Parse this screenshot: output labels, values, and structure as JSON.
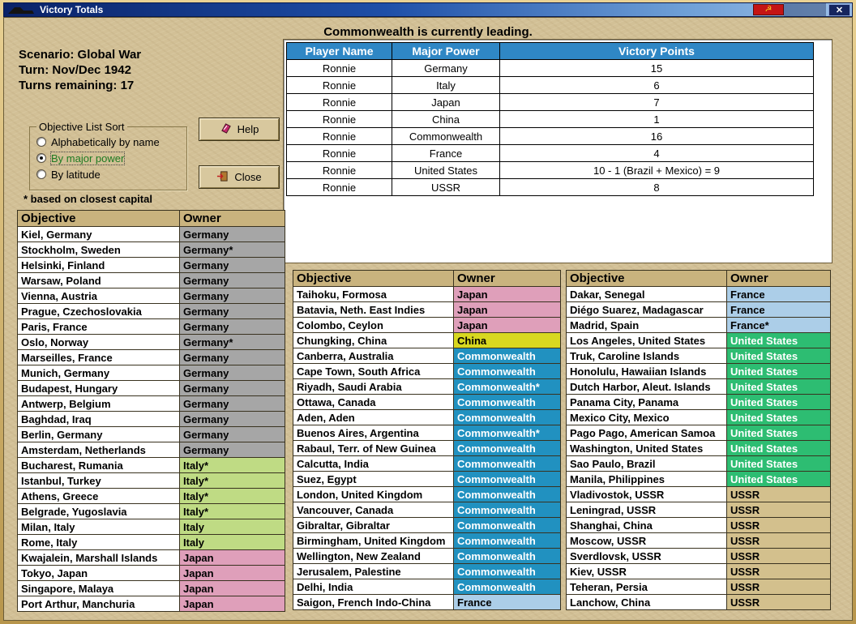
{
  "window": {
    "title": "Victory Totals",
    "heading": "Commonwealth is currently leading."
  },
  "titlebar": {
    "flag_glyph": "☭",
    "close_glyph": "✕"
  },
  "info": {
    "scenario": "Scenario: Global War",
    "turn": "Turn: Nov/Dec 1942",
    "turns_remaining": "Turns remaining: 17",
    "footnote": "* based on closest capital"
  },
  "sort_box": {
    "title": "Objective List Sort",
    "options": [
      {
        "label": "Alphabetically by name",
        "selected": false
      },
      {
        "label": "By major power",
        "selected": true
      },
      {
        "label": "By latitude",
        "selected": false
      }
    ]
  },
  "buttons": {
    "help": "Help",
    "close": "Close"
  },
  "players_table": {
    "headers": [
      "Player Name",
      "Major Power",
      "Victory Points"
    ],
    "rows": [
      [
        "Ronnie",
        "Germany",
        "15"
      ],
      [
        "Ronnie",
        "Italy",
        "6"
      ],
      [
        "Ronnie",
        "Japan",
        "7"
      ],
      [
        "Ronnie",
        "China",
        "1"
      ],
      [
        "Ronnie",
        "Commonwealth",
        "16"
      ],
      [
        "Ronnie",
        "France",
        "4"
      ],
      [
        "Ronnie",
        "United States",
        "10 - 1 (Brazil + Mexico) = 9"
      ],
      [
        "Ronnie",
        "USSR",
        "8"
      ]
    ]
  },
  "objective_tables": [
    {
      "headers": [
        "Objective",
        "Owner"
      ],
      "rows": [
        [
          "Kiel, Germany",
          "Germany"
        ],
        [
          "Stockholm, Sweden",
          "Germany*"
        ],
        [
          "Helsinki, Finland",
          "Germany"
        ],
        [
          "Warsaw, Poland",
          "Germany"
        ],
        [
          "Vienna, Austria",
          "Germany"
        ],
        [
          "Prague, Czechoslovakia",
          "Germany"
        ],
        [
          "Paris, France",
          "Germany"
        ],
        [
          "Oslo, Norway",
          "Germany*"
        ],
        [
          "Marseilles, France",
          "Germany"
        ],
        [
          "Munich, Germany",
          "Germany"
        ],
        [
          "Budapest, Hungary",
          "Germany"
        ],
        [
          "Antwerp, Belgium",
          "Germany"
        ],
        [
          "Baghdad, Iraq",
          "Germany"
        ],
        [
          "Berlin, Germany",
          "Germany"
        ],
        [
          "Amsterdam, Netherlands",
          "Germany"
        ],
        [
          "Bucharest, Rumania",
          "Italy*"
        ],
        [
          "Istanbul, Turkey",
          "Italy*"
        ],
        [
          "Athens, Greece",
          "Italy*"
        ],
        [
          "Belgrade, Yugoslavia",
          "Italy*"
        ],
        [
          "Milan, Italy",
          "Italy"
        ],
        [
          "Rome, Italy",
          "Italy"
        ],
        [
          "Kwajalein, Marshall Islands",
          "Japan"
        ],
        [
          "Tokyo, Japan",
          "Japan"
        ],
        [
          "Singapore, Malaya",
          "Japan"
        ],
        [
          "Port Arthur, Manchuria",
          "Japan"
        ]
      ]
    },
    {
      "headers": [
        "Objective",
        "Owner"
      ],
      "rows": [
        [
          "Taihoku, Formosa",
          "Japan"
        ],
        [
          "Batavia, Neth. East Indies",
          "Japan"
        ],
        [
          "Colombo, Ceylon",
          "Japan"
        ],
        [
          "Chungking, China",
          "China"
        ],
        [
          "Canberra, Australia",
          "Commonwealth"
        ],
        [
          "Cape Town, South Africa",
          "Commonwealth"
        ],
        [
          "Riyadh, Saudi Arabia",
          "Commonwealth*"
        ],
        [
          "Ottawa, Canada",
          "Commonwealth"
        ],
        [
          "Aden, Aden",
          "Commonwealth"
        ],
        [
          "Buenos Aires, Argentina",
          "Commonwealth*"
        ],
        [
          "Rabaul, Terr. of New Guinea",
          "Commonwealth"
        ],
        [
          "Calcutta, India",
          "Commonwealth"
        ],
        [
          "Suez, Egypt",
          "Commonwealth"
        ],
        [
          "London, United Kingdom",
          "Commonwealth"
        ],
        [
          "Vancouver, Canada",
          "Commonwealth"
        ],
        [
          "Gibraltar, Gibraltar",
          "Commonwealth"
        ],
        [
          "Birmingham, United Kingdom",
          "Commonwealth"
        ],
        [
          "Wellington, New Zealand",
          "Commonwealth"
        ],
        [
          "Jerusalem, Palestine",
          "Commonwealth"
        ],
        [
          "Delhi, India",
          "Commonwealth"
        ],
        [
          "Saigon, French Indo-China",
          "France"
        ]
      ]
    },
    {
      "headers": [
        "Objective",
        "Owner"
      ],
      "rows": [
        [
          "Dakar, Senegal",
          "France"
        ],
        [
          "Diégo Suarez, Madagascar",
          "France"
        ],
        [
          "Madrid, Spain",
          "France*"
        ],
        [
          "Los Angeles, United States",
          "United States"
        ],
        [
          "Truk, Caroline Islands",
          "United States"
        ],
        [
          "Honolulu, Hawaiian Islands",
          "United States"
        ],
        [
          "Dutch Harbor, Aleut. Islands",
          "United States"
        ],
        [
          "Panama City, Panama",
          "United States"
        ],
        [
          "Mexico City, Mexico",
          "United States"
        ],
        [
          "Pago Pago, American Samoa",
          "United States"
        ],
        [
          "Washington, United States",
          "United States"
        ],
        [
          "Sao Paulo, Brazil",
          "United States"
        ],
        [
          "Manila, Philippines",
          "United States"
        ],
        [
          "Vladivostok, USSR",
          "USSR"
        ],
        [
          "Leningrad, USSR",
          "USSR"
        ],
        [
          "Shanghai, China",
          "USSR"
        ],
        [
          "Moscow, USSR",
          "USSR"
        ],
        [
          "Sverdlovsk, USSR",
          "USSR"
        ],
        [
          "Kiev, USSR",
          "USSR"
        ],
        [
          "Teheran, Persia",
          "USSR"
        ],
        [
          "Lanchow, China",
          "USSR"
        ]
      ]
    }
  ],
  "owner_colors": {
    "Germany": {
      "bg": "#a6a6a6",
      "fg": "#000000"
    },
    "Italy": {
      "bg": "#bfdb84",
      "fg": "#000000"
    },
    "Japan": {
      "bg": "#df9fba",
      "fg": "#000000"
    },
    "China": {
      "bg": "#d8d820",
      "fg": "#000000"
    },
    "Commonwealth": {
      "bg": "#2191c0",
      "fg": "#ffffff"
    },
    "France": {
      "bg": "#accee8",
      "fg": "#000000"
    },
    "United States": {
      "bg": "#2dbd72",
      "fg": "#ffffff"
    },
    "USSR": {
      "bg": "#d3c08d",
      "fg": "#000000"
    }
  }
}
